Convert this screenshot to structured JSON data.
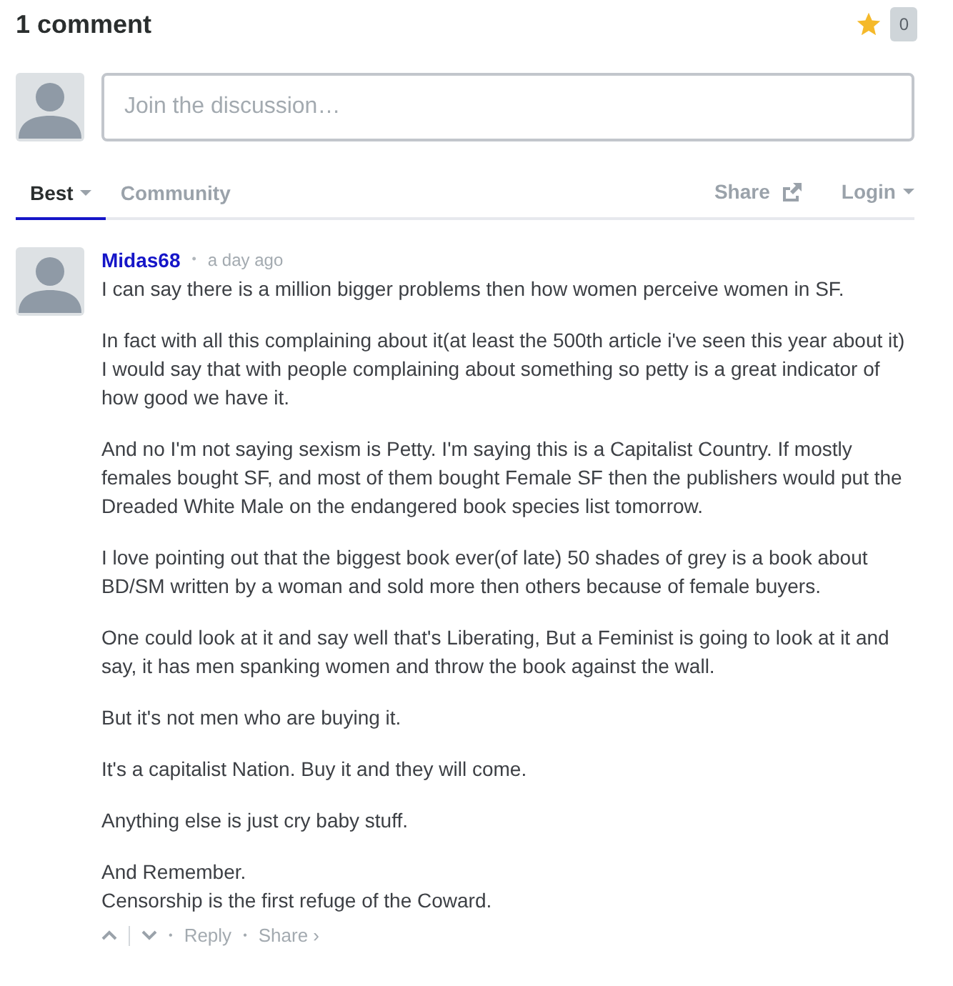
{
  "header": {
    "title": "1 comment",
    "count": "0"
  },
  "compose": {
    "placeholder": "Join the discussion…"
  },
  "tabs": [
    {
      "label": "Best",
      "selected": true,
      "dropdown": true
    },
    {
      "label": "Community",
      "selected": false,
      "dropdown": false
    }
  ],
  "actions": {
    "share": "Share",
    "login": "Login"
  },
  "comment": {
    "author": "Midas68",
    "separator": "•",
    "time": "a day ago",
    "paragraphs": [
      {
        "lines": [
          "I can say there is a million bigger problems then how women perceive women in SF."
        ]
      },
      {
        "lines": [
          "In fact with all this complaining about it(at least the 500th article i've seen this year about it) I would say that with people complaining about something so petty is a great indicator of how good we have it."
        ]
      },
      {
        "lines": [
          "And no I'm not saying sexism is Petty. I'm saying this is a Capitalist Country. If mostly females bought SF, and most of them bought Female SF then the publishers would put the Dreaded White Male on the endangered book species list tomorrow."
        ]
      },
      {
        "lines": [
          "I love pointing out that the biggest book ever(of late) 50 shades of grey is a book about BD/SM written by a woman and sold more then others because of female buyers."
        ]
      },
      {
        "lines": [
          "One could look at it and say well that's Liberating, But a Feminist is going to look at it and say, it has men spanking women and throw the book against the wall."
        ]
      },
      {
        "lines": [
          "But it's not men who are buying it."
        ]
      },
      {
        "lines": [
          "It's a capitalist Nation. Buy it and they will come."
        ]
      },
      {
        "lines": [
          "Anything else is just cry baby stuff."
        ]
      },
      {
        "lines": [
          "And Remember.",
          "Censorship is the first refuge of the Coward."
        ]
      }
    ],
    "footer": {
      "dot1": "•",
      "reply": "Reply",
      "dot2": "•",
      "share": "Share ›"
    }
  }
}
